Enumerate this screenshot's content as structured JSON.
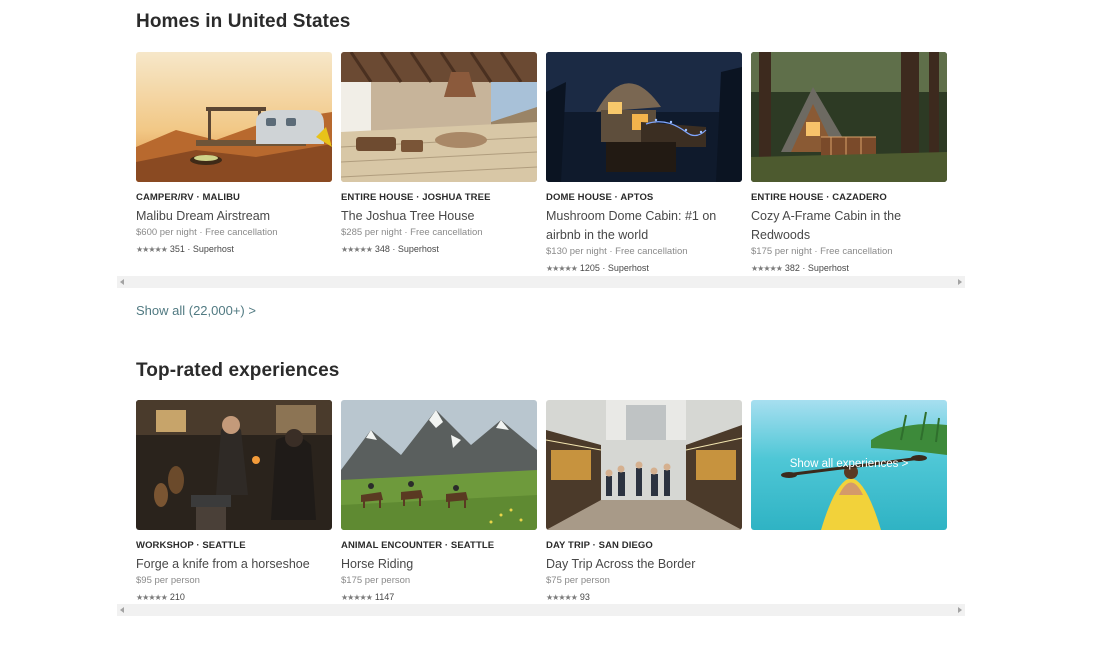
{
  "homes": {
    "title": "Homes in United States",
    "show_all": "Show all (22,000+) >",
    "cards": [
      {
        "kicker": "CAMPER/RV · MALIBU",
        "title": "Malibu Dream Airstream",
        "price": "$600 per night · Free cancellation",
        "reviews": "351 · Superhost",
        "stars": "★★★★★"
      },
      {
        "kicker": "ENTIRE HOUSE · JOSHUA TREE",
        "title": "The Joshua Tree House",
        "price": "$285 per night · Free cancellation",
        "reviews": "348 · Superhost",
        "stars": "★★★★★"
      },
      {
        "kicker": "DOME HOUSE · APTOS",
        "title": "Mushroom Dome Cabin: #1 on airbnb in the world",
        "price": "$130 per night · Free cancellation",
        "reviews": "1205 · Superhost",
        "stars": "★★★★★"
      },
      {
        "kicker": "ENTIRE HOUSE · CAZADERO",
        "title": "Cozy A-Frame Cabin in the Redwoods",
        "price": "$175 per night · Free cancellation",
        "reviews": "382 · Superhost",
        "stars": "★★★★★"
      }
    ]
  },
  "experiences": {
    "title": "Top-rated experiences",
    "overlay_link": "Show all experiences >",
    "cards": [
      {
        "kicker": "WORKSHOP · SEATTLE",
        "title": "Forge a knife from a horseshoe",
        "price": "$95 per person",
        "reviews": "210",
        "stars": "★★★★★"
      },
      {
        "kicker": "ANIMAL ENCOUNTER · SEATTLE",
        "title": "Horse Riding",
        "price": "$175 per person",
        "reviews": "1147",
        "stars": "★★★★★"
      },
      {
        "kicker": "DAY TRIP · SAN DIEGO",
        "title": "Day Trip Across the Border",
        "price": "$75 per person",
        "reviews": "93",
        "stars": "★★★★★"
      }
    ]
  },
  "icons": {
    "scroll_left": "scroll-left-arrow-icon",
    "scroll_right": "scroll-right-arrow-icon"
  },
  "colors": {
    "link": "#517a82",
    "heading": "#2b2b2b",
    "text": "#484848",
    "muted": "#8a8a8a"
  }
}
